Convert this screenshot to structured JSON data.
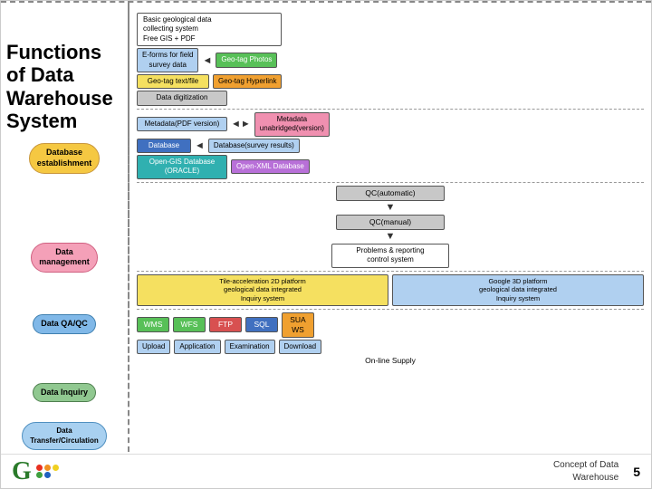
{
  "title": "Functions of Data Warehouse System",
  "top_dashed": true,
  "left_labels": {
    "db_establishment": "Database\nestablishment",
    "data_management": "Data\nmanagement",
    "data_qaqc": "Data\nQA/QC",
    "data_inquiry": "Data\nInquiry",
    "data_transfer": "Data\nTransfer/Circulation"
  },
  "sections": {
    "db_establish": {
      "row1": {
        "col1": "Basic geological data\ncollecting system\nFree GIS + PDF"
      },
      "row2": {
        "col1": "E-forms for field\nsurvey data",
        "arrow": "◄",
        "col2": "Geo-tag Photos"
      },
      "row3": {
        "col1": "Geo-tag text/file",
        "col2": "Geo-tag Hyperlink"
      },
      "row4": "Data digitization"
    },
    "data_management": {
      "row1": {
        "col1": "Metadata(PDF version)",
        "arrow": "◄►",
        "col2": "Metadata\nunabridged(version)"
      },
      "row2": {
        "col1": "Database",
        "arrow": "◄",
        "col2": "Database(survey results)"
      },
      "row3": {
        "col1": "Open-GIS Database\n(ORACLE)",
        "col2": "Open-XML Database"
      }
    },
    "data_qaqc": {
      "row1": "QC(automatic)",
      "row2": "QC(manual)",
      "row3": "Problems & reporting\ncontrol system"
    },
    "data_inquiry": {
      "row1": {
        "col1": "Tile-acceleration 2D platform\ngeological data integrated\nInquiry system",
        "col2": "Google 3D platform\ngeological data integrated\nInquiry system"
      }
    },
    "data_transfer": {
      "row1": {
        "items": [
          "WMS",
          "WFS",
          "FTP",
          "SQL",
          "SUA\nWS"
        ]
      },
      "row2": {
        "items": [
          "Upload",
          "Application",
          "Examination",
          "Download"
        ]
      },
      "row3": "On-line Supply"
    }
  },
  "logo": {
    "letter": "G",
    "dots": [
      "#e83020",
      "#f09020",
      "#f0d020",
      "#40a040",
      "#2060c0"
    ]
  },
  "concept_label": "Concept of Data\nWarehouse",
  "page_number": "5"
}
